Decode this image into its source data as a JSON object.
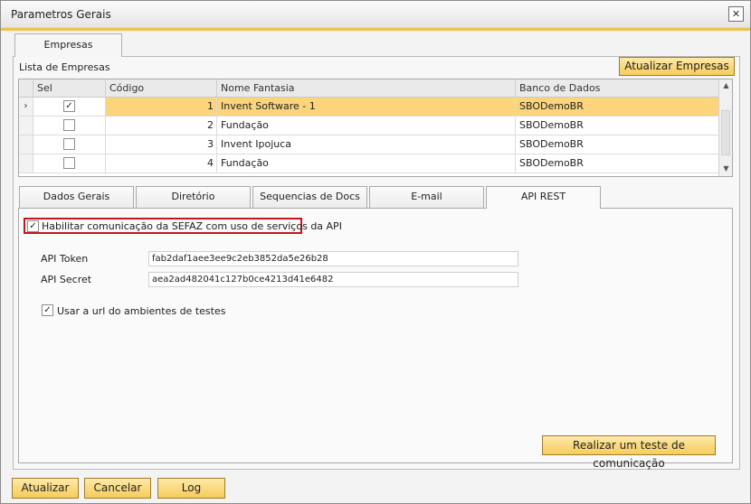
{
  "window": {
    "title": "Parametros Gerais",
    "close_glyph": "✕"
  },
  "top_tab": {
    "label": "Empresas"
  },
  "companies": {
    "list_label": "Lista de Empresas",
    "update_button": "Atualizar Empresas",
    "columns": [
      "Sel",
      "Código",
      "Nome Fantasia",
      "Banco de Dados"
    ],
    "rows": [
      {
        "selected": true,
        "checked": true,
        "code": "1",
        "name": "Invent Software - 1",
        "db": "SBODemoBR"
      },
      {
        "selected": false,
        "checked": false,
        "code": "2",
        "name": "Fundação",
        "db": "SBODemoBR"
      },
      {
        "selected": false,
        "checked": false,
        "code": "3",
        "name": "Invent Ipojuca",
        "db": "SBODemoBR"
      },
      {
        "selected": false,
        "checked": false,
        "code": "4",
        "name": "Fundação",
        "db": "SBODemoBR"
      }
    ],
    "row_marker": "›"
  },
  "tabs": [
    {
      "label": "Dados Gerais"
    },
    {
      "label": "Diretório"
    },
    {
      "label": "Sequencias de Docs"
    },
    {
      "label": "E-mail"
    },
    {
      "label": "API REST"
    }
  ],
  "api_rest": {
    "enable_label": "Habilitar comunicação da SEFAZ com uso de serviços da API",
    "enable_checked": true,
    "token_label": "API Token",
    "token_value": "fab2daf1aee3ee9c2eb3852da5e26b28",
    "secret_label": "API Secret",
    "secret_value": "aea2ad482041c127b0ce4213d41e6482",
    "test_url_label": "Usar a url do ambientes de testes",
    "test_url_checked": true,
    "test_button": "Realizar um teste de comunicação"
  },
  "footer": {
    "update_button": "Atualizar",
    "cancel_button": "Cancelar",
    "log_button": "Log"
  }
}
